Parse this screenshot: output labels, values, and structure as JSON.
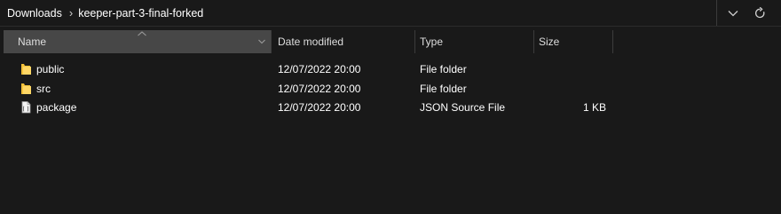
{
  "address": {
    "crumbs": [
      "Downloads",
      "keeper-part-3-final-forked"
    ]
  },
  "columns": {
    "name": "Name",
    "date_modified": "Date modified",
    "type": "Type",
    "size": "Size"
  },
  "files": [
    {
      "name": "public",
      "date": "12/07/2022 20:00",
      "type": "File folder",
      "size": "",
      "icon": "folder-icon"
    },
    {
      "name": "src",
      "date": "12/07/2022 20:00",
      "type": "File folder",
      "size": "",
      "icon": "folder-icon"
    },
    {
      "name": "package",
      "date": "12/07/2022 20:00",
      "type": "JSON Source File",
      "size": "1 KB",
      "icon": "json-file-icon"
    }
  ],
  "colors": {
    "background": "#191919",
    "header_active": "#474747",
    "folder": "#f3c13a"
  }
}
